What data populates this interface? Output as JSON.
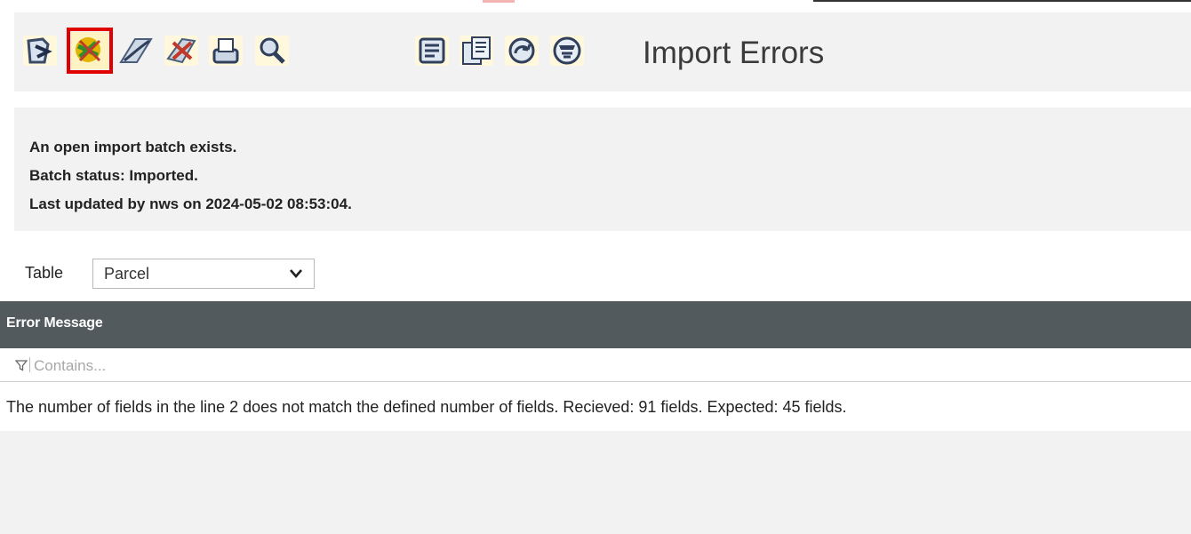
{
  "toolbar": {
    "title": "Import Errors",
    "icons": [
      {
        "name": "import-icon"
      },
      {
        "name": "cancel-batch-icon",
        "selected": true
      },
      {
        "name": "validate-icon"
      },
      {
        "name": "delete-batch-icon"
      },
      {
        "name": "print-icon"
      },
      {
        "name": "search-icon"
      },
      {
        "name": "summary-report-icon"
      },
      {
        "name": "documents-icon"
      },
      {
        "name": "refresh-icon"
      },
      {
        "name": "filter-list-icon"
      }
    ]
  },
  "status": {
    "line1": "An open import batch exists.",
    "line2": "Batch status: Imported.",
    "line3": "Last updated by nws on 2024-05-02 08:53:04."
  },
  "table_selector": {
    "label": "Table",
    "selected": "Parcel"
  },
  "grid": {
    "column_header": "Error Message",
    "filter_placeholder": "Contains...",
    "rows": [
      {
        "message": "The number of fields in the line 2 does not match the defined number of fields. Recieved: 91 fields. Expected: 45 fields."
      }
    ]
  },
  "colors": {
    "selected_outline": "#e00000",
    "header_bg": "#525a5d",
    "panel_bg": "#f2f2f2"
  }
}
